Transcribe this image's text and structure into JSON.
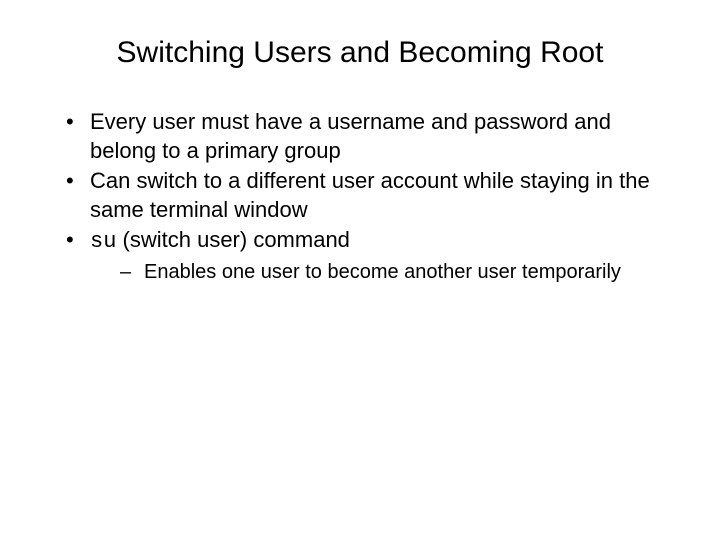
{
  "title": "Switching Users and Becoming Root",
  "bullets": [
    {
      "text": "Every user must have a username and password and belong to a primary group"
    },
    {
      "text": "Can switch to a different user account while staying in the same terminal window"
    },
    {
      "code": "su",
      "after": " (switch user) command",
      "subs": [
        {
          "text": "Enables one user to become another user temporarily"
        }
      ]
    }
  ]
}
